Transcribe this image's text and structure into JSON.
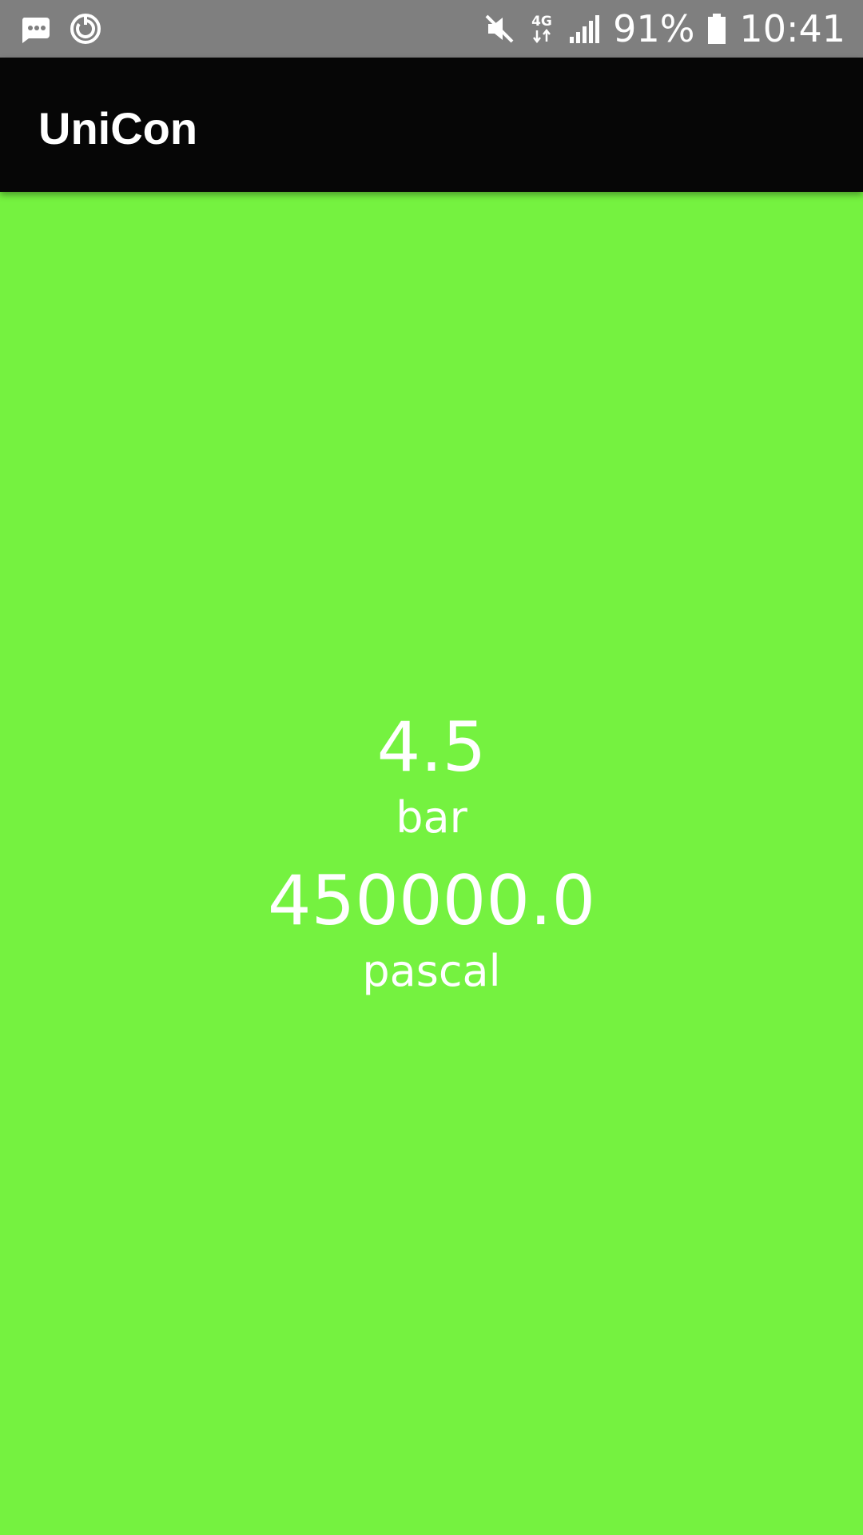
{
  "status_bar": {
    "left_icons": [
      "message-icon",
      "sync-icon"
    ],
    "right_icons": [
      "mute-icon",
      "network-4g-icon",
      "signal-icon",
      "battery-icon"
    ],
    "network_label": "4G",
    "battery_percent": "91%",
    "time": "10:41"
  },
  "app_bar": {
    "title": "UniCon"
  },
  "conversion": {
    "input_value": "4.5",
    "input_unit": "bar",
    "output_value": "450000.0",
    "output_unit": "pascal"
  },
  "colors": {
    "background": "#75f240",
    "app_bar": "#060606",
    "status_bar": "#7f7f7f",
    "text": "#ffffff"
  }
}
